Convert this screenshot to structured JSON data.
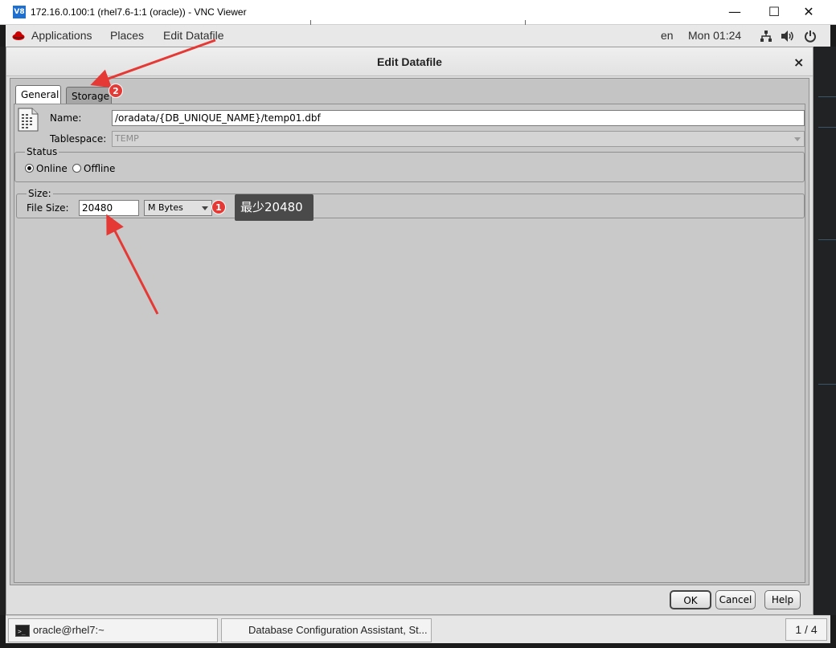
{
  "vnc": {
    "icon_text": "V8",
    "title": "172.16.0.100:1 (rhel7.6-1:1 (oracle)) - VNC Viewer",
    "minimize": "—",
    "maximize": "☐",
    "close": "✕"
  },
  "panel": {
    "applications": "Applications",
    "places": "Places",
    "active_app": "Edit Datafile",
    "language": "en",
    "clock": "Mon 01:24"
  },
  "dialog": {
    "title": "Edit Datafile",
    "close": "×",
    "tabs": [
      {
        "label": "General",
        "active": true
      },
      {
        "label": "Storage",
        "active": false
      }
    ],
    "general": {
      "name_label": "Name:",
      "name_value": "/oradata/{DB_UNIQUE_NAME}/temp01.dbf",
      "tablespace_label": "Tablespace:",
      "tablespace_value": "TEMP",
      "status": {
        "legend": "Status",
        "options": [
          {
            "label": "Online",
            "checked": true
          },
          {
            "label": "Offline",
            "checked": false
          }
        ]
      },
      "size": {
        "legend": "Size:",
        "file_size_label": "File Size:",
        "file_size_value": "20480",
        "unit": "M Bytes"
      }
    },
    "buttons": {
      "ok": "OK",
      "cancel": "Cancel",
      "help": "Help"
    }
  },
  "annotations": {
    "badge_1": "1",
    "badge_2": "2",
    "callout_1": "最少20480",
    "color": "#e53935"
  },
  "taskbar": {
    "tasks": [
      {
        "label": "oracle@rhel7:~"
      },
      {
        "label": "Database Configuration Assistant, St..."
      }
    ],
    "workspace": "1 / 4"
  }
}
